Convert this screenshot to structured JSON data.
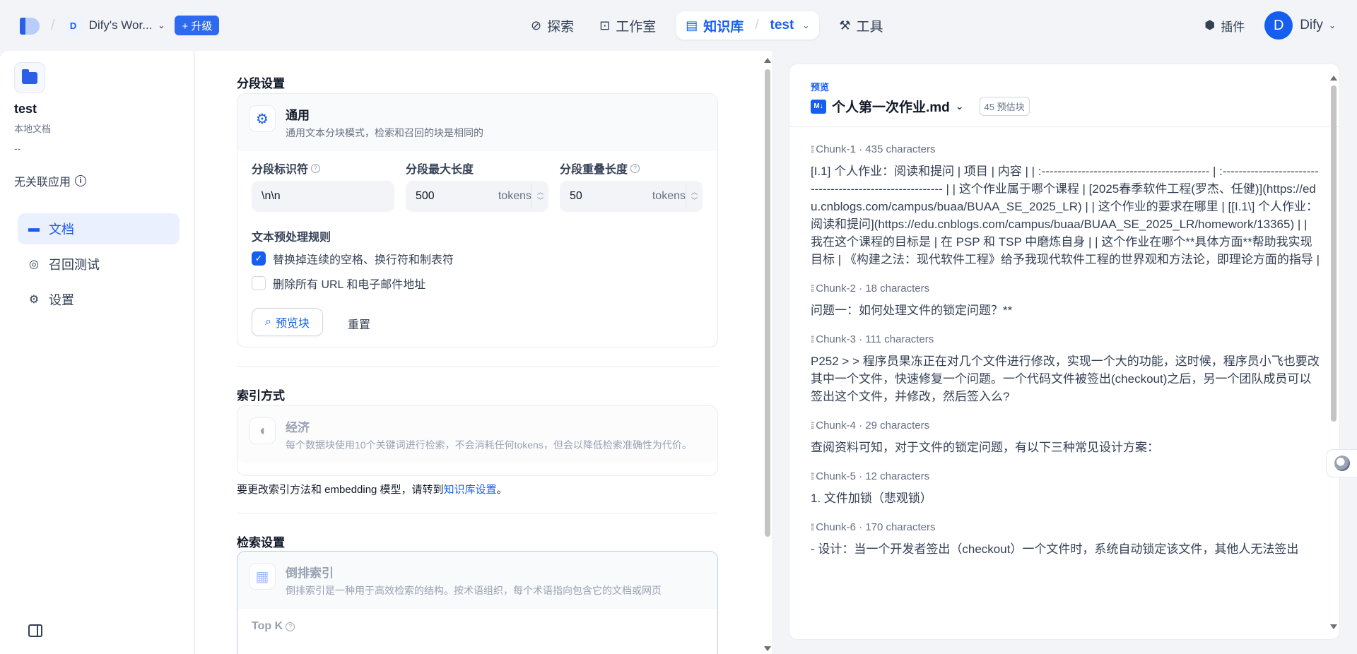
{
  "topbar": {
    "workspace_initial": "D",
    "workspace_name": "Dify's Wor...",
    "upgrade_label": "+ 升级",
    "nav": {
      "explore": "探索",
      "studio": "工作室",
      "knowledge": "知识库",
      "knowledge_sub": "test",
      "tools": "工具"
    },
    "plugins": "插件",
    "user_initial": "D",
    "user_name": "Dify"
  },
  "sidebar": {
    "dataset_name": "test",
    "dataset_type": "本地文档",
    "dataset_desc": "--",
    "no_app": "无关联应用",
    "items": [
      {
        "label": "文档",
        "icon": "document-icon"
      },
      {
        "label": "召回测试",
        "icon": "target-icon"
      },
      {
        "label": "设置",
        "icon": "gear-icon"
      }
    ]
  },
  "segment": {
    "title": "分段设置",
    "mode_title": "通用",
    "mode_desc": "通用文本分块模式，检索和召回的块是相同的",
    "separator_label": "分段标识符",
    "separator_value": "\\n\\n",
    "max_len_label": "分段最大长度",
    "max_len_value": "500",
    "overlap_label": "分段重叠长度",
    "overlap_value": "50",
    "unit": "tokens",
    "rules_title": "文本预处理规则",
    "rule1": "替换掉连续的空格、换行符和制表符",
    "rule1_checked": true,
    "rule2": "删除所有 URL 和电子邮件地址",
    "rule2_checked": false,
    "preview_btn": "预览块",
    "reset_btn": "重置"
  },
  "index": {
    "title": "索引方式",
    "mode_title": "经济",
    "mode_desc": "每个数据块使用10个关键词进行检索，不会消耗任何tokens，但会以降低检索准确性为代价。",
    "note_prefix": "要更改索引方法和 embedding 模型，请转到",
    "note_link": "知识库设置",
    "note_suffix": "。"
  },
  "retrieval": {
    "title": "检索设置",
    "mode_title": "倒排索引",
    "mode_desc": "倒排索引是一种用于高效检索的结构。按术语组织，每个术语指向包含它的文档或网页",
    "topk_label": "Top K"
  },
  "preview": {
    "label": "预览",
    "file_name": "个人第一次作业.md",
    "badge": "45 预估块",
    "chunks": [
      {
        "meta": "Chunk-1 · 435 characters",
        "text": "[I.1] 个人作业：阅读和提问 | 项目 | 内容 | | :------------------------------------------ | :--------------------------------------------------------- | | 这个作业属于哪个课程 | [2025春季软件工程(罗杰、任健)](https://edu.cnblogs.com/campus/buaa/BUAA_SE_2025_LR) | | 这个作业的要求在哪里 | [[I.1\\] 个人作业：阅读和提问](https://edu.cnblogs.com/campus/buaa/BUAA_SE_2025_LR/homework/13365) | | 我在这个课程的目标是 | 在 PSP 和 TSP 中磨炼自身 | | 这个作业在哪个**具体方面**帮助我实现目标 | 《构建之法：现代软件工程》给予我现代软件工程的世界观和方法论，即理论方面的指导 |"
      },
      {
        "meta": "Chunk-2 · 18 characters",
        "text": "问题一：如何处理文件的锁定问题？**"
      },
      {
        "meta": "Chunk-3 · 111 characters",
        "text": "P252 > > 程序员果冻正在对几个文件进行修改，实现一个大的功能，这时候，程序员小飞也要改其中一个文件，快速修复一个问题。一个代码文件被签出(checkout)之后，另一个团队成员可以签出这个文件，并修改，然后签入么?"
      },
      {
        "meta": "Chunk-4 · 29 characters",
        "text": "查阅资料可知，对于文件的锁定问题，有以下三种常见设计方案："
      },
      {
        "meta": "Chunk-5 · 12 characters",
        "text": "1. 文件加锁（悲观锁）"
      },
      {
        "meta": "Chunk-6 · 170 characters",
        "text": "- 设计：当一个开发者签出（checkout）一个文件时，系统自动锁定该文件，其他人无法签出"
      }
    ]
  },
  "colors": {
    "accent": "#155eef",
    "background": "#f2f4f7"
  }
}
